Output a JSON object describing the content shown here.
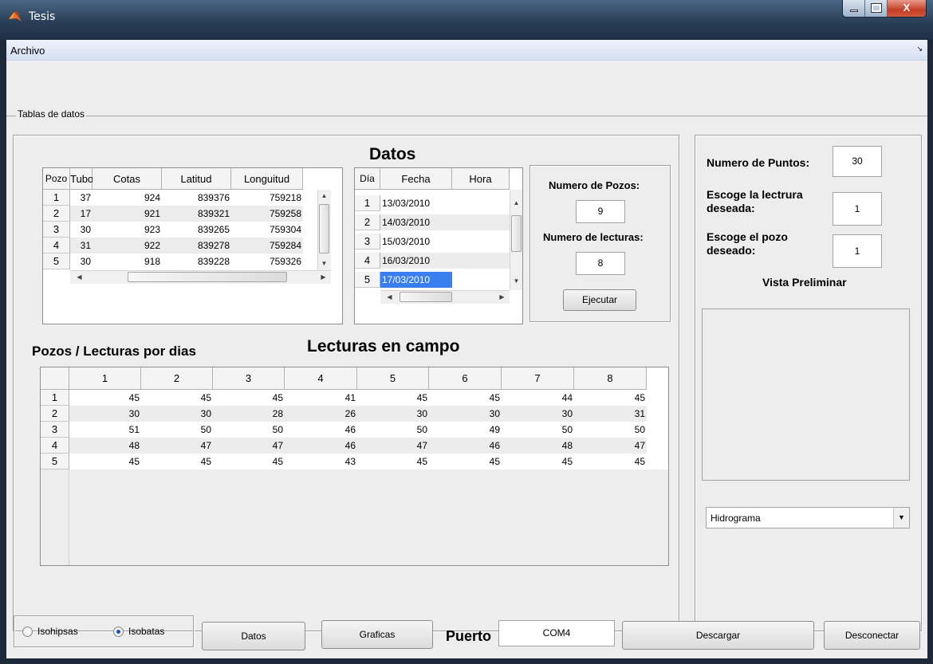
{
  "window": {
    "title": "Tesis",
    "close_glyph": "X"
  },
  "menu": {
    "archivo": "Archivo",
    "overflow_arrow": "↘"
  },
  "groups": {
    "tablas_de_datos": "Tablas de datos"
  },
  "headings": {
    "datos": "Datos",
    "lecturas_en_campo": "Lecturas en campo",
    "pozos_lecturas": "Pozos / Lecturas por dias"
  },
  "pozos_table": {
    "columns": [
      "Pozo",
      "Tubo",
      "Cotas",
      "Latitud",
      "Longuitud"
    ],
    "rows": [
      [
        "1",
        "37",
        "924",
        "839376",
        "759218"
      ],
      [
        "2",
        "17",
        "921",
        "839321",
        "759258"
      ],
      [
        "3",
        "30",
        "923",
        "839265",
        "759304"
      ],
      [
        "4",
        "31",
        "922",
        "839278",
        "759284"
      ],
      [
        "5",
        "30",
        "918",
        "839228",
        "759326"
      ]
    ]
  },
  "fechas_table": {
    "columns": [
      "Día",
      "Fecha",
      "Hora"
    ],
    "rows": [
      [
        "1",
        "13/03/2010",
        ""
      ],
      [
        "2",
        "14/03/2010",
        ""
      ],
      [
        "3",
        "15/03/2010",
        ""
      ],
      [
        "4",
        "16/03/2010",
        ""
      ],
      [
        "5",
        "17/03/2010",
        ""
      ]
    ],
    "selected_row": 5
  },
  "config_panel": {
    "numero_pozos_label": "Numero de Pozos:",
    "numero_pozos_value": "9",
    "numero_lecturas_label": "Numero de lecturas:",
    "numero_lecturas_value": "8",
    "ejecutar": "Ejecutar"
  },
  "lecturas_table": {
    "columns": [
      "1",
      "2",
      "3",
      "4",
      "5",
      "6",
      "7",
      "8"
    ],
    "rows": [
      [
        "1",
        "45",
        "45",
        "45",
        "41",
        "45",
        "45",
        "44",
        "45"
      ],
      [
        "2",
        "30",
        "30",
        "28",
        "26",
        "30",
        "30",
        "30",
        "31"
      ],
      [
        "3",
        "51",
        "50",
        "50",
        "46",
        "50",
        "49",
        "50",
        "50"
      ],
      [
        "4",
        "48",
        "47",
        "47",
        "46",
        "47",
        "46",
        "48",
        "47"
      ],
      [
        "5",
        "45",
        "45",
        "45",
        "43",
        "45",
        "45",
        "45",
        "45"
      ]
    ]
  },
  "right_panel": {
    "numero_puntos_label": "Numero de Puntos:",
    "numero_puntos_value": "30",
    "lectura_label_1": "Escoge la lectrura",
    "lectura_label_2": "deseada:",
    "lectura_value": "1",
    "pozo_label_1": "Escoge el pozo",
    "pozo_label_2": "deseado:",
    "pozo_value": "1",
    "vista_preliminar": "Vista Preliminar",
    "plot_type": "Hidrograma"
  },
  "bottom_bar": {
    "isohipsas": "Isohipsas",
    "isobatas": "Isobatas",
    "isohipsas_selected": false,
    "isobatas_selected": true,
    "datos": "Datos",
    "graficas": "Graficas",
    "puerto_label": "Puerto",
    "puerto_value": "COM4",
    "descargar": "Descargar",
    "desconectar": "Desconectar"
  }
}
